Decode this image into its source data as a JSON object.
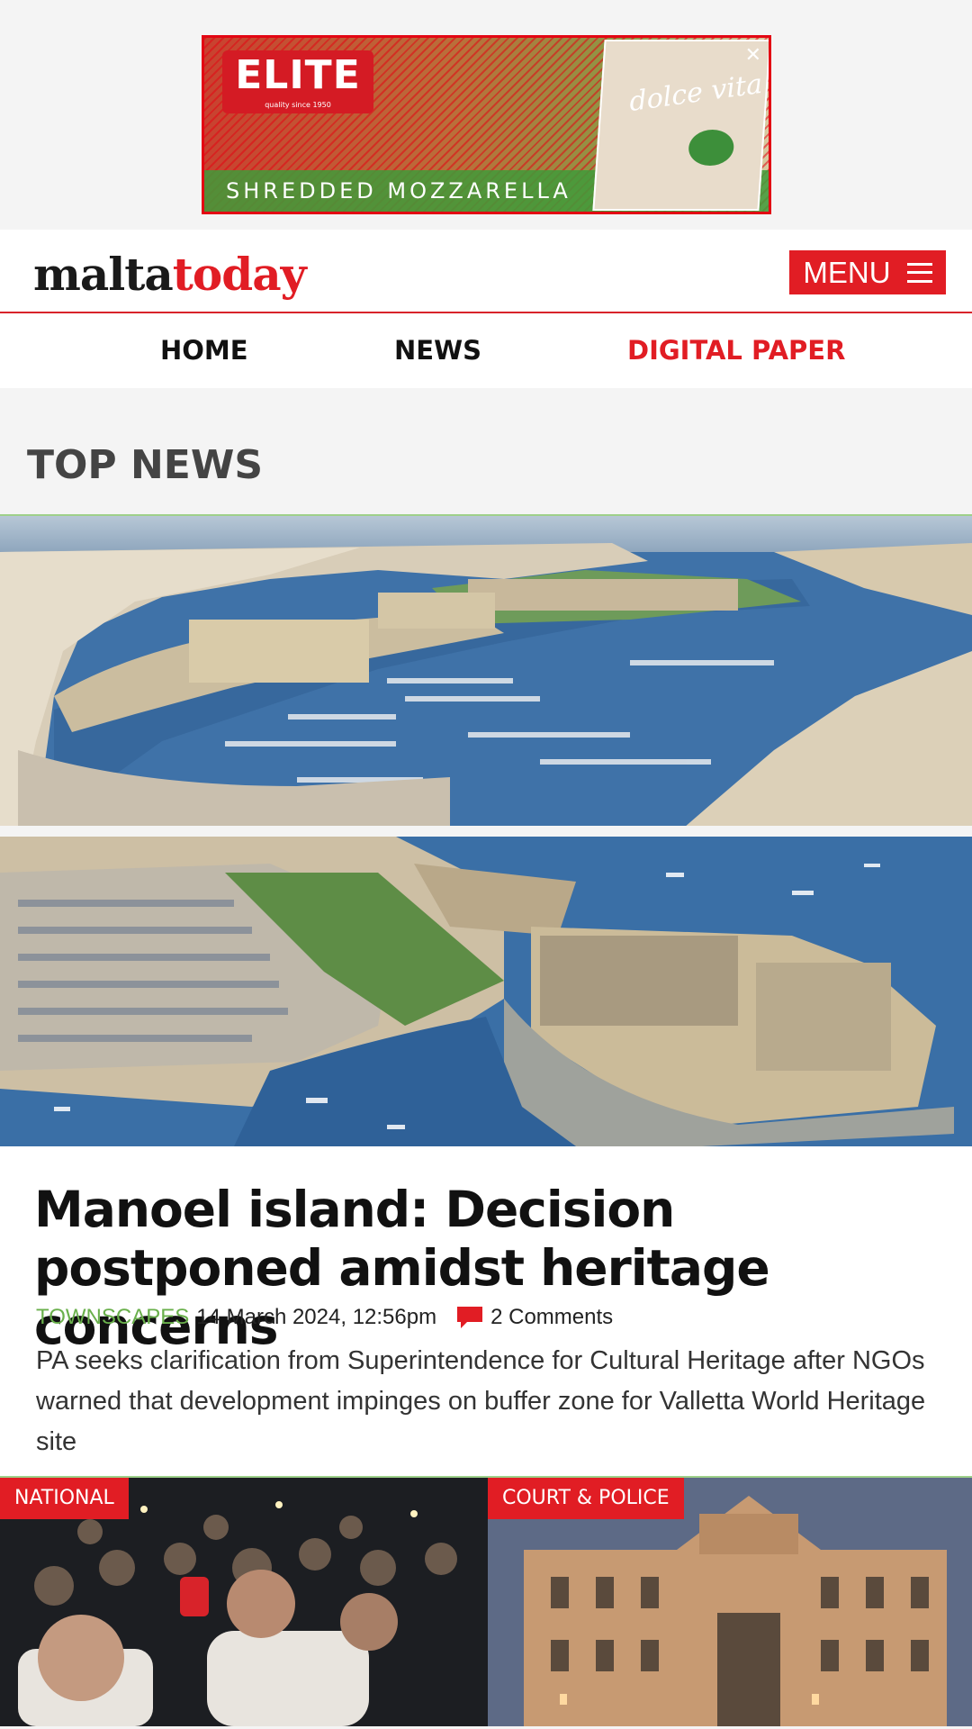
{
  "ad": {
    "brand": "ELITE",
    "brand_sub": "quality since 1950",
    "tagline": "SHREDDED MOZZARELLA",
    "pack_brand": "dolce vita",
    "close": "✕"
  },
  "header": {
    "logo_part1": "malta",
    "logo_part2": "today",
    "menu_label": "MENU"
  },
  "nav": {
    "items": [
      "HOME",
      "NEWS",
      "DIGITAL PAPER"
    ],
    "active_color": "#e11d24"
  },
  "section": {
    "title": "TOP NEWS"
  },
  "article": {
    "headline": "Manoel island: Decision postponed amidst heritage concerns",
    "category": "TOWNSCAPES",
    "date": "14 March 2024, 12:56pm",
    "comments": "2 Comments",
    "summary": "PA seeks clarification from Superintendence for Cultural Heritage after NGOs warned that development impinges on buffer zone for Valletta World Heritage site"
  },
  "cards": [
    {
      "tag": "NATIONAL"
    },
    {
      "tag": "COURT & POLICE"
    }
  ],
  "colors": {
    "accent": "#e11d24",
    "category_green": "#6ab04c"
  }
}
